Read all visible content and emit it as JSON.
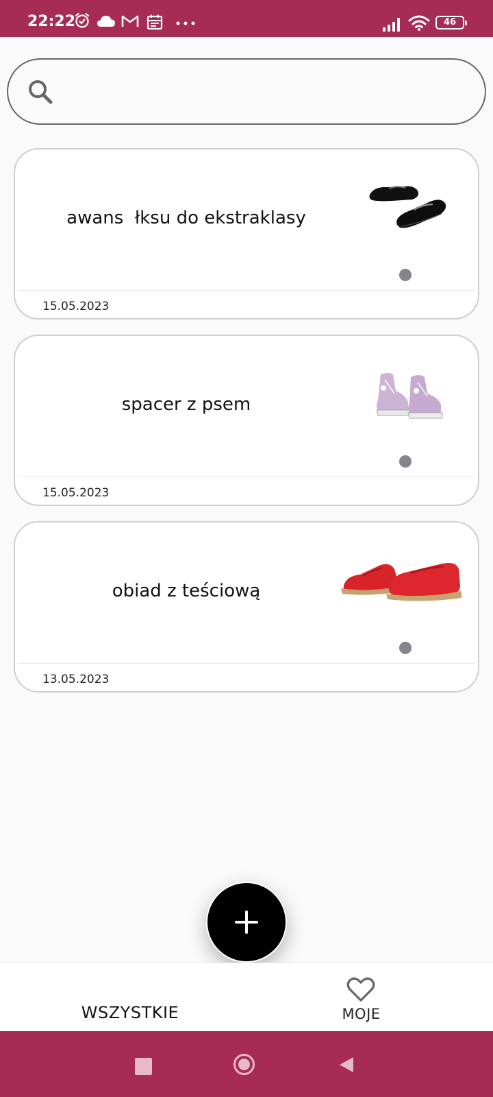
{
  "status_bar": {
    "time": "22:22",
    "battery": "46",
    "icons": [
      "alarm-icon",
      "cloud-icon",
      "gmail-icon",
      "calendar-icon",
      "more-dots-icon",
      "signal-icon",
      "wifi-icon",
      "battery-icon"
    ]
  },
  "search": {
    "placeholder": "",
    "value": "",
    "icon": "search-icon"
  },
  "notes": [
    {
      "title": "awans  łksu do ekstraklasy",
      "date": "15.05.2023",
      "image": "black-dress-shoes-image"
    },
    {
      "title": "spacer z psem",
      "date": "15.05.2023",
      "image": "lilac-sneakers-image"
    },
    {
      "title": "obiad z teściową",
      "date": "13.05.2023",
      "image": "red-loafers-image"
    }
  ],
  "fab": {
    "icon": "plus-icon"
  },
  "bottom_nav": {
    "all_label": "WSZYSTKIE",
    "mine_label": "MOJE",
    "mine_icon": "heart-icon"
  },
  "system_nav": [
    "recent-apps-icon",
    "home-icon",
    "back-icon"
  ],
  "colors": {
    "accent": "#a62b55",
    "fab": "#000000",
    "dot": "#85848f"
  }
}
